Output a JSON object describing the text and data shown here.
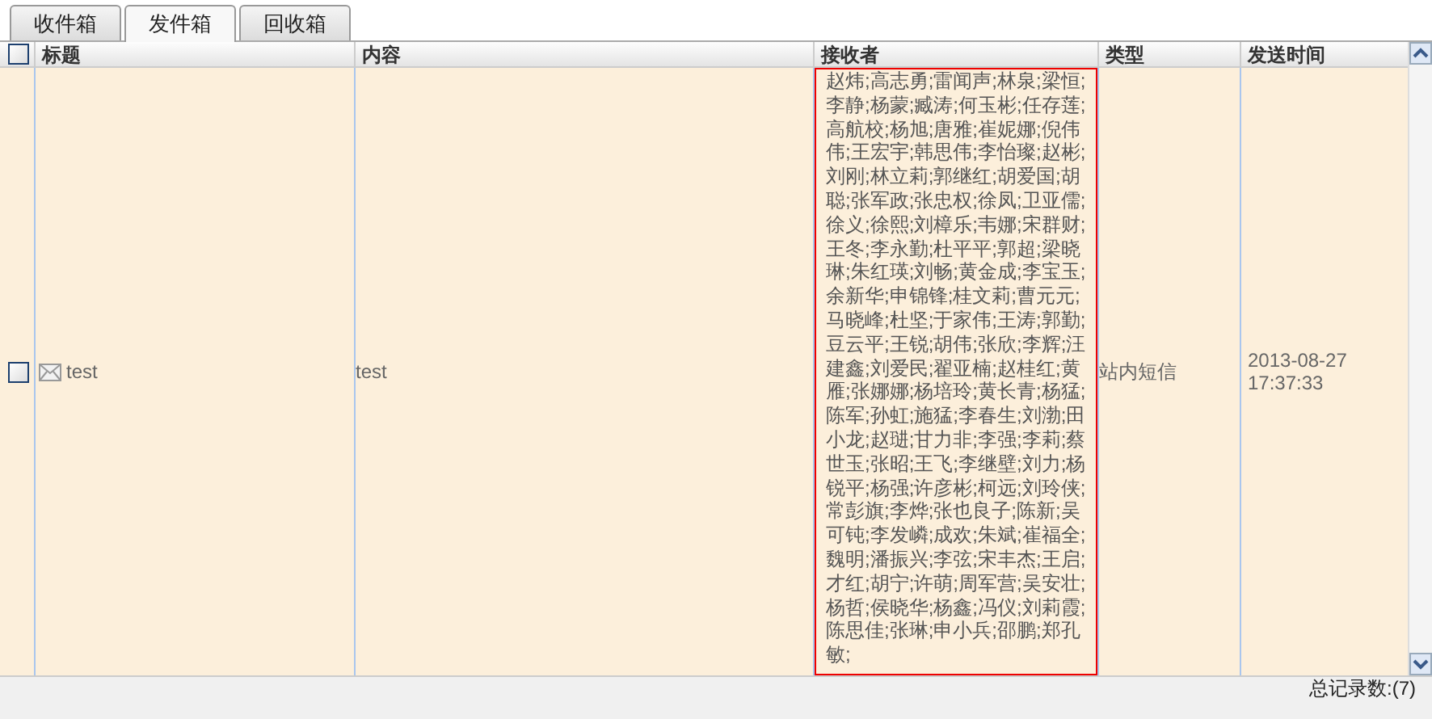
{
  "tabs": [
    {
      "label": "收件箱",
      "selected": false
    },
    {
      "label": "发件箱",
      "selected": true
    },
    {
      "label": "回收箱",
      "selected": false
    }
  ],
  "table": {
    "select_all_checked": false,
    "columns": [
      "标题",
      "内容",
      "接收者",
      "类型",
      "发送时间"
    ],
    "rows": [
      {
        "checked": false,
        "title": "test",
        "content": "test",
        "recipients_outlined": true,
        "recipients": "赵炜;高志勇;雷闻声;林泉;梁恒;李静;杨蒙;臧涛;何玉彬;任存莲;高航校;杨旭;唐雅;崔妮娜;倪伟伟;王宏宇;韩思伟;李怡璨;赵彬;刘刚;林立莉;郭继红;胡爱国;胡聪;张军政;张忠权;徐凤;卫亚儒;徐义;徐熙;刘樟乐;韦娜;宋群财;王冬;李永勤;杜平平;郭超;梁晓琳;朱红瑛;刘畅;黄金成;李宝玉;余新华;申锦锋;桂文莉;曹元元;马晓峰;杜坚;于家伟;王涛;郭勤;豆云平;王锐;胡伟;张欣;李辉;汪建鑫;刘爱民;翟亚楠;赵桂红;黄雁;张娜娜;杨培玲;黄长青;杨猛;陈军;孙虹;施猛;李春生;刘渤;田小龙;赵琎;甘力非;李强;李莉;蔡世玉;张昭;王飞;李继壁;刘力;杨锐平;杨强;许彦彬;柯远;刘玲侠;常彭旗;李烨;张也良子;陈新;吴可钝;李发嶙;成欢;朱斌;崔福全;魏明;潘振兴;李弦;宋丰杰;王启;才红;胡宁;许萌;周军营;吴安壮;杨哲;侯晓华;杨鑫;冯仪;刘莉霞;陈思佳;张琳;申小兵;邵鹏;郑孔敏;",
        "type": "站内短信",
        "date": "2013-08-27",
        "time": "17:37:33"
      }
    ]
  },
  "footer": {
    "total": "总记录数:(7)"
  }
}
